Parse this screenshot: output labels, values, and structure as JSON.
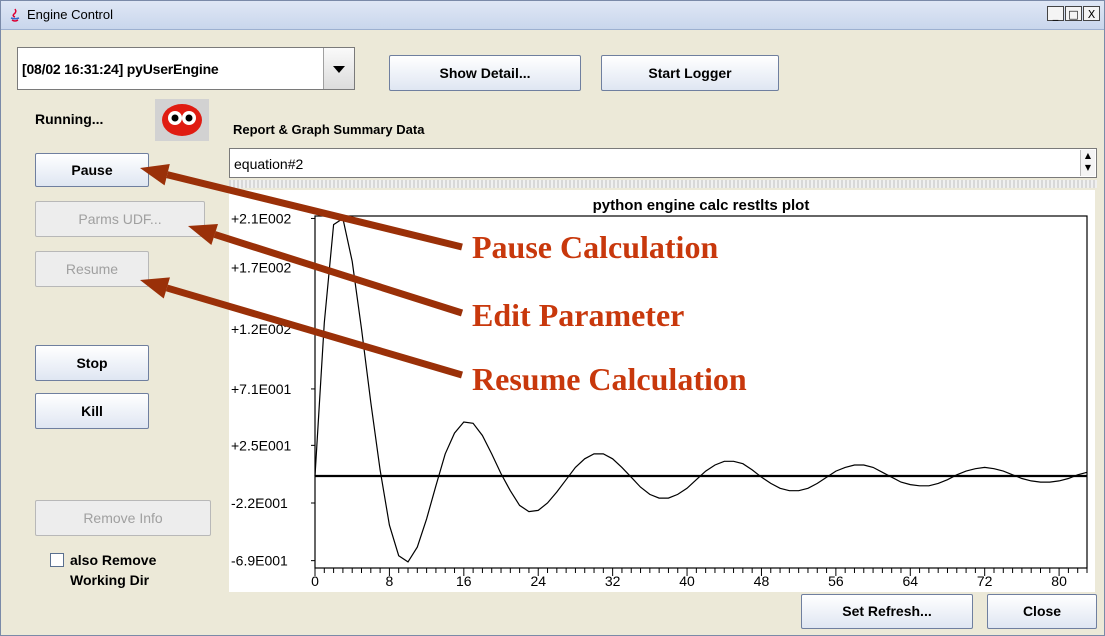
{
  "window": {
    "title": "Engine Control",
    "title_controls": [
      "_",
      "□",
      "X"
    ]
  },
  "combo": {
    "value": "[08/02 16:31:24] pyUserEngine"
  },
  "toolbar": {
    "show_detail": "Show Detail...",
    "start_logger": "Start Logger"
  },
  "status": {
    "label": "Running...",
    "icon": "face-icon"
  },
  "report": {
    "label": "Report & Graph Summary Data",
    "equation": "equation#2"
  },
  "side_buttons": {
    "pause": "Pause",
    "parms_udf": "Parms UDF...",
    "resume": "Resume",
    "stop": "Stop",
    "kill": "Kill",
    "remove_info": "Remove Info",
    "also_remove": "also Remove\nWorking Dir"
  },
  "footer": {
    "set_refresh": "Set Refresh...",
    "close": "Close"
  },
  "annotations": {
    "pause": "Pause Calculation",
    "edit": "Edit Parameter",
    "resume": "Resume Calculation",
    "color": "#c8380c",
    "arrow_color": "#9a3008"
  },
  "chart_data": {
    "type": "line",
    "title": "python engine calc restlts plot",
    "ytick_labels": [
      "+2.1E002",
      "+1.7E002",
      "+1.2E002",
      "+7.1E001",
      "+2.5E001",
      "-2.2E001",
      "-6.9E001"
    ],
    "yticks": [
      210,
      170,
      120,
      71,
      25,
      -22,
      -69
    ],
    "ylim": [
      -75,
      212
    ],
    "xlim": [
      0,
      83
    ],
    "xticks": [
      0,
      8,
      16,
      24,
      32,
      40,
      48,
      56,
      64,
      72,
      80
    ],
    "series": [
      {
        "x": [
          0,
          1,
          2,
          3,
          4,
          5,
          6,
          7,
          8,
          9,
          10,
          11,
          12,
          13,
          14,
          15,
          16,
          17,
          18,
          19,
          20,
          21,
          22,
          23,
          24,
          25,
          26,
          27,
          28,
          29,
          30,
          31,
          32,
          33,
          34,
          35,
          36,
          37,
          38,
          39,
          40,
          41,
          42,
          43,
          44,
          45,
          46,
          47,
          48,
          49,
          50,
          51,
          52,
          53,
          54,
          55,
          56,
          57,
          58,
          59,
          60,
          61,
          62,
          63,
          64,
          65,
          66,
          67,
          68,
          69,
          70,
          71,
          72,
          73,
          74,
          75,
          76,
          77,
          78,
          79,
          80,
          81,
          82,
          83
        ],
        "y": [
          0,
          125,
          205,
          210,
          175,
          120,
          60,
          5,
          -40,
          -65,
          -70,
          -58,
          -35,
          -8,
          18,
          35,
          44,
          43,
          33,
          18,
          2,
          -12,
          -24,
          -29,
          -28,
          -22,
          -13,
          -3,
          7,
          14,
          18,
          18,
          14,
          7,
          -1,
          -9,
          -15,
          -18,
          -18,
          -15,
          -10,
          -3,
          4,
          9,
          12,
          12,
          10,
          5,
          -1,
          -6,
          -10,
          -12,
          -12,
          -10,
          -6,
          -1,
          4,
          7,
          9,
          9,
          7,
          3,
          -1,
          -5,
          -7,
          -8,
          -8,
          -6,
          -3,
          1,
          4,
          6,
          7,
          6,
          4,
          1,
          -2,
          -4,
          -5,
          -5,
          -4,
          -2,
          1,
          3
        ]
      },
      {
        "x": [
          0,
          83
        ],
        "y": [
          0,
          0
        ]
      }
    ]
  }
}
